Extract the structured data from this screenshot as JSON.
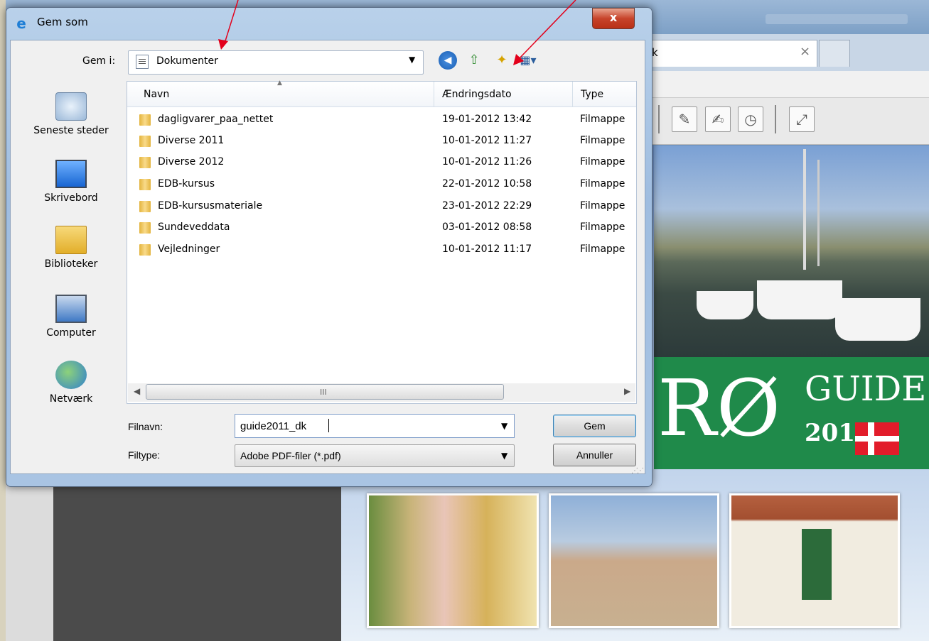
{
  "dialog": {
    "title": "Gem som",
    "close_label": "x",
    "save_in_label": "Gem i:",
    "location": "Dokumenter",
    "filename_label": "Filnavn:",
    "filename_value": "guide2011_dk",
    "filetype_label": "Filtype:",
    "filetype_value": "Adobe PDF-filer (*.pdf)",
    "save_button": "Gem",
    "cancel_button": "Annuller"
  },
  "places": [
    {
      "label": "Seneste steder",
      "icon": "recent-places-icon"
    },
    {
      "label": "Skrivebord",
      "icon": "desktop-icon"
    },
    {
      "label": "Biblioteker",
      "icon": "libraries-icon"
    },
    {
      "label": "Computer",
      "icon": "computer-icon"
    },
    {
      "label": "Netværk",
      "icon": "network-icon"
    }
  ],
  "columns": {
    "name": "Navn",
    "date": "Ændringsdato",
    "type": "Type"
  },
  "files": [
    {
      "name": "dagligvarer_paa_nettet",
      "date": "19-01-2012 13:42",
      "type": "Filmappe"
    },
    {
      "name": "Diverse 2011",
      "date": "10-01-2012 11:27",
      "type": "Filmappe"
    },
    {
      "name": "Diverse 2012",
      "date": "10-01-2012 11:26",
      "type": "Filmappe"
    },
    {
      "name": "EDB-kursus",
      "date": "22-01-2012 10:58",
      "type": "Filmappe"
    },
    {
      "name": "EDB-kursusmateriale",
      "date": "23-01-2012 22:29",
      "type": "Filmappe"
    },
    {
      "name": "Sundeveddata",
      "date": "03-01-2012 08:58",
      "type": "Filmappe"
    },
    {
      "name": "Vejledninger",
      "date": "10-01-2012 11:17",
      "type": "Filmappe"
    }
  ],
  "browser": {
    "tab_label": "k",
    "tab_close": "×"
  },
  "brochure": {
    "brand_big": "RØ",
    "brand_word": "GUIDE",
    "brand_year": "2011"
  },
  "colors": {
    "accent_red": "#e21c2a",
    "brand_green": "#1f8a4a"
  }
}
